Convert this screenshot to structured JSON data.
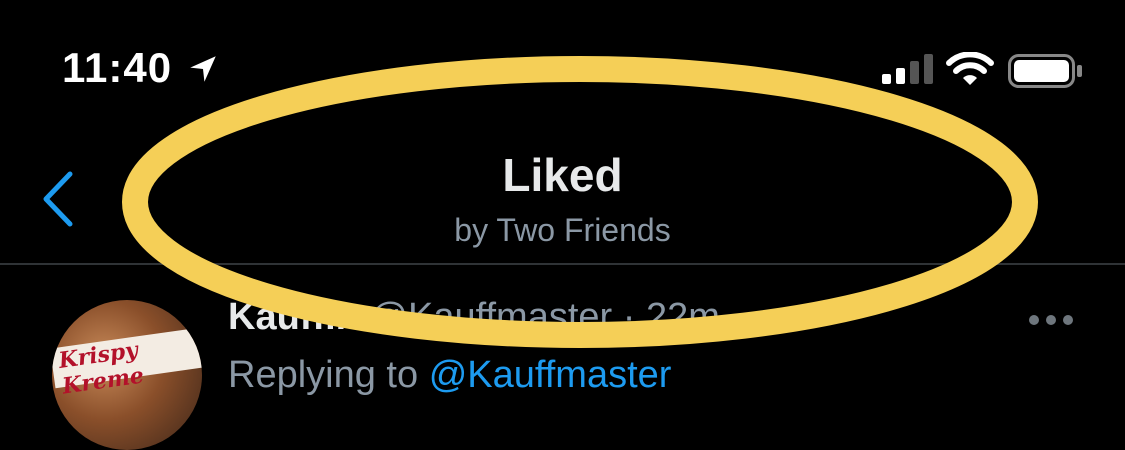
{
  "status_bar": {
    "time": "11:40",
    "icons": [
      "location-arrow-icon",
      "cellular-signal-icon",
      "wifi-icon",
      "battery-icon"
    ]
  },
  "nav": {
    "back_icon": "chevron-left-icon",
    "title": "Liked",
    "subtitle": "by Two Friends"
  },
  "tweet": {
    "name": "Kauffin",
    "handle": "@Kauffmaster",
    "separator": "·",
    "time": "22m",
    "reply_prefix": "Replying to",
    "reply_handle": "@Kauffmaster",
    "avatar_text": "Krispy Kreme",
    "more_icon": "more-horizontal-icon"
  },
  "colors": {
    "background": "#000000",
    "accent_blue": "#1d9bf0",
    "secondary_text": "#8b98a5",
    "highlight_yellow": "#f5cf57"
  }
}
